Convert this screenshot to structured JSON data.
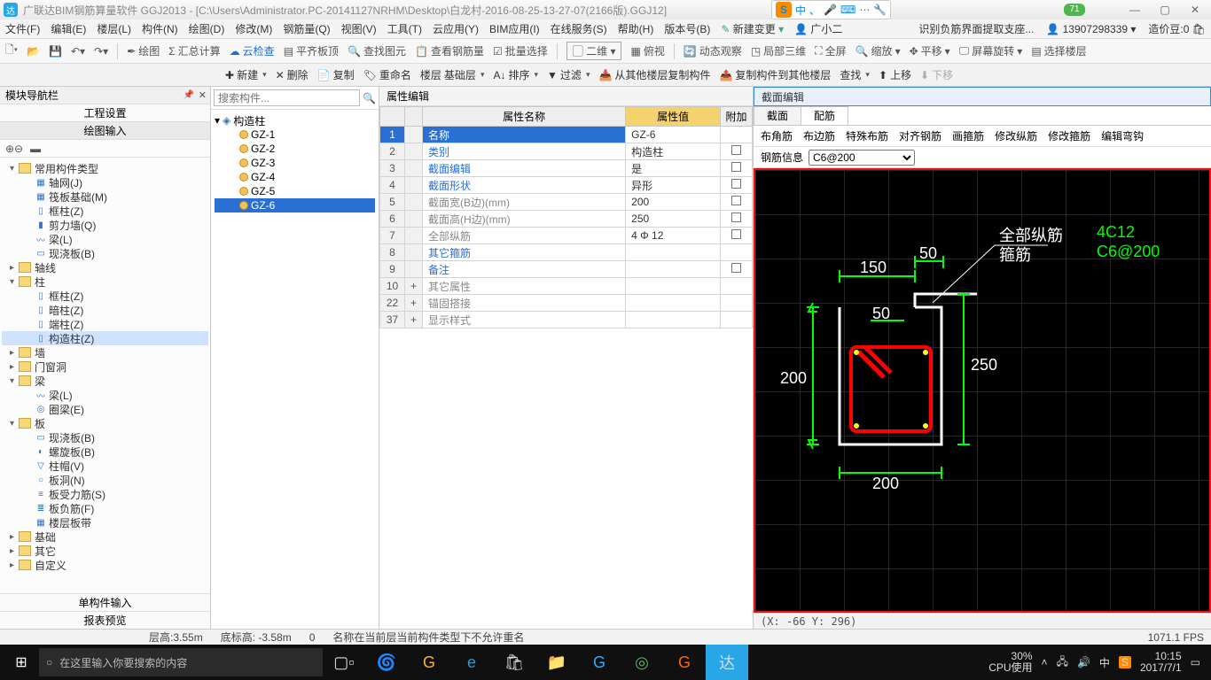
{
  "title": "广联达BIM钢筋算量软件 GGJ2013 - [C:\\Users\\Administrator.PC-20141127NRHM\\Desktop\\白龙村-2016-08-25-13-27-07(2166版).GGJ12]",
  "ime": {
    "s": "S",
    "items": [
      "中",
      "、",
      "🎤",
      "⌨",
      "⋯",
      "🔧"
    ]
  },
  "greenbadge": "71",
  "menu": [
    "文件(F)",
    "编辑(E)",
    "楼层(L)",
    "构件(N)",
    "绘图(D)",
    "修改(M)",
    "钢筋量(Q)",
    "视图(V)",
    "工具(T)",
    "云应用(Y)",
    "BIM应用(I)",
    "在线服务(S)",
    "帮助(H)",
    "版本号(B)"
  ],
  "menu_right": {
    "newchange": "新建变更",
    "user": "广小二",
    "orange": "识别负筋界面提取支座...",
    "phone": "13907298339",
    "cost": "造价豆:0"
  },
  "toolbar1": {
    "items": [
      "绘图",
      "汇总计算",
      "云检查",
      "平齐板顶",
      "查找图元",
      "查看钢筋量",
      "批量选择"
    ],
    "view2d": "二维",
    "views": [
      "俯视",
      "动态观察",
      "局部三维",
      "全屏",
      "缩放",
      "平移",
      "屏幕旋转",
      "选择楼层"
    ]
  },
  "toolbar2": {
    "new": "新建",
    "del": "删除",
    "copy": "复制",
    "rename": "重命名",
    "floor": "楼层",
    "base": "基础层",
    "sort": "排序",
    "filter": "过滤",
    "copyfrom": "从其他楼层复制构件",
    "copyto": "复制构件到其他楼层",
    "find": "查找",
    "up": "上移",
    "down": "下移"
  },
  "sidebar": {
    "title": "模块导航栏",
    "tab1": "工程设置",
    "tab2": "绘图输入",
    "tree": [
      {
        "d": 0,
        "tw": "▾",
        "fd": 1,
        "label": "常用构件类型"
      },
      {
        "d": 1,
        "ic": "▦",
        "label": "轴网(J)"
      },
      {
        "d": 1,
        "ic": "▦",
        "label": "筏板基础(M)"
      },
      {
        "d": 1,
        "ic": "▯",
        "label": "框柱(Z)"
      },
      {
        "d": 1,
        "ic": "▮",
        "label": "剪力墙(Q)"
      },
      {
        "d": 1,
        "ic": "〰",
        "label": "梁(L)"
      },
      {
        "d": 1,
        "ic": "▭",
        "label": "现浇板(B)"
      },
      {
        "d": 0,
        "tw": "▸",
        "fd": 1,
        "label": "轴线"
      },
      {
        "d": 0,
        "tw": "▾",
        "fd": 1,
        "label": "柱"
      },
      {
        "d": 1,
        "ic": "▯",
        "label": "框柱(Z)"
      },
      {
        "d": 1,
        "ic": "▯",
        "label": "暗柱(Z)"
      },
      {
        "d": 1,
        "ic": "▯",
        "label": "端柱(Z)"
      },
      {
        "d": 1,
        "ic": "▯",
        "label": "构造柱(Z)",
        "sel": 1
      },
      {
        "d": 0,
        "tw": "▸",
        "fd": 1,
        "label": "墙"
      },
      {
        "d": 0,
        "tw": "▸",
        "fd": 1,
        "label": "门窗洞"
      },
      {
        "d": 0,
        "tw": "▾",
        "fd": 1,
        "label": "梁"
      },
      {
        "d": 1,
        "ic": "〰",
        "label": "梁(L)"
      },
      {
        "d": 1,
        "ic": "◎",
        "label": "圈梁(E)"
      },
      {
        "d": 0,
        "tw": "▾",
        "fd": 1,
        "label": "板"
      },
      {
        "d": 1,
        "ic": "▭",
        "label": "现浇板(B)"
      },
      {
        "d": 1,
        "ic": "◐",
        "label": "螺旋板(B)"
      },
      {
        "d": 1,
        "ic": "▽",
        "label": "柱帽(V)"
      },
      {
        "d": 1,
        "ic": "○",
        "label": "板洞(N)"
      },
      {
        "d": 1,
        "ic": "≡",
        "label": "板受力筋(S)"
      },
      {
        "d": 1,
        "ic": "≣",
        "label": "板负筋(F)"
      },
      {
        "d": 1,
        "ic": "▦",
        "label": "楼层板带"
      },
      {
        "d": 0,
        "tw": "▸",
        "fd": 1,
        "label": "基础"
      },
      {
        "d": 0,
        "tw": "▸",
        "fd": 1,
        "label": "其它"
      },
      {
        "d": 0,
        "tw": "▸",
        "fd": 1,
        "label": "自定义"
      }
    ],
    "foot1": "单构件输入",
    "foot2": "报表预览"
  },
  "complist": {
    "placeholder": "搜索构件...",
    "root": "构造柱",
    "items": [
      "GZ-1",
      "GZ-2",
      "GZ-3",
      "GZ-4",
      "GZ-5"
    ],
    "selected": "GZ-6"
  },
  "prop": {
    "title": "属性编辑",
    "head": {
      "name": "属性名称",
      "value": "属性值",
      "attach": "附加"
    },
    "rows": [
      {
        "n": "1",
        "name": "名称",
        "val": "GZ-6",
        "link": 1,
        "sel": 1
      },
      {
        "n": "2",
        "name": "类别",
        "val": "构造柱",
        "link": 1,
        "chk": 1
      },
      {
        "n": "3",
        "name": "截面编辑",
        "val": "是",
        "link": 1,
        "chk": 1
      },
      {
        "n": "4",
        "name": "截面形状",
        "val": "异形",
        "link": 1,
        "chk": 1
      },
      {
        "n": "5",
        "name": "截面宽(B边)(mm)",
        "val": "200",
        "gray": 1,
        "chk": 1
      },
      {
        "n": "6",
        "name": "截面高(H边)(mm)",
        "val": "250",
        "gray": 1,
        "chk": 1
      },
      {
        "n": "7",
        "name": "全部纵筋",
        "val": "4 Φ 12",
        "gray": 1,
        "chk": 1
      },
      {
        "n": "8",
        "name": "其它箍筋",
        "val": "",
        "link": 1
      },
      {
        "n": "9",
        "name": "备注",
        "val": "",
        "link": 1,
        "chk": 1
      },
      {
        "n": "10",
        "name": "其它属性",
        "val": "",
        "gray": 1,
        "exp": "+"
      },
      {
        "n": "22",
        "name": "锚固搭接",
        "val": "",
        "gray": 1,
        "exp": "+"
      },
      {
        "n": "37",
        "name": "显示样式",
        "val": "",
        "gray": 1,
        "exp": "+"
      }
    ]
  },
  "section": {
    "title": "截面编辑",
    "tabs": [
      "截面",
      "配筋"
    ],
    "bar": [
      "布角筋",
      "布边筋",
      "特殊布筋",
      "对齐钢筋",
      "画箍筋",
      "修改纵筋",
      "修改箍筋",
      "编辑弯钩"
    ],
    "info_label": "钢筋信息",
    "info_val": "C6@200",
    "annot": {
      "a": "全部纵筋",
      "b": "箍筋",
      "c": "4C12",
      "d": "C6@200"
    },
    "dims": {
      "w": "200",
      "h": "250",
      "top1": "150",
      "top2": "50",
      "top3": "50",
      "left": "200"
    },
    "status": "(X: -66 Y: 296)"
  },
  "statusbar": {
    "h": "层高:3.55m",
    "b": "底标高: -3.58m",
    "z": "0",
    "msg": "名称在当前层当前构件类型下不允许重名",
    "fps": "1071.1 FPS"
  },
  "taskbar": {
    "search": "在这里输入你要搜索的内容",
    "cpu": "30%",
    "cpul": "CPU使用",
    "time": "10:15",
    "date": "2017/7/1"
  }
}
